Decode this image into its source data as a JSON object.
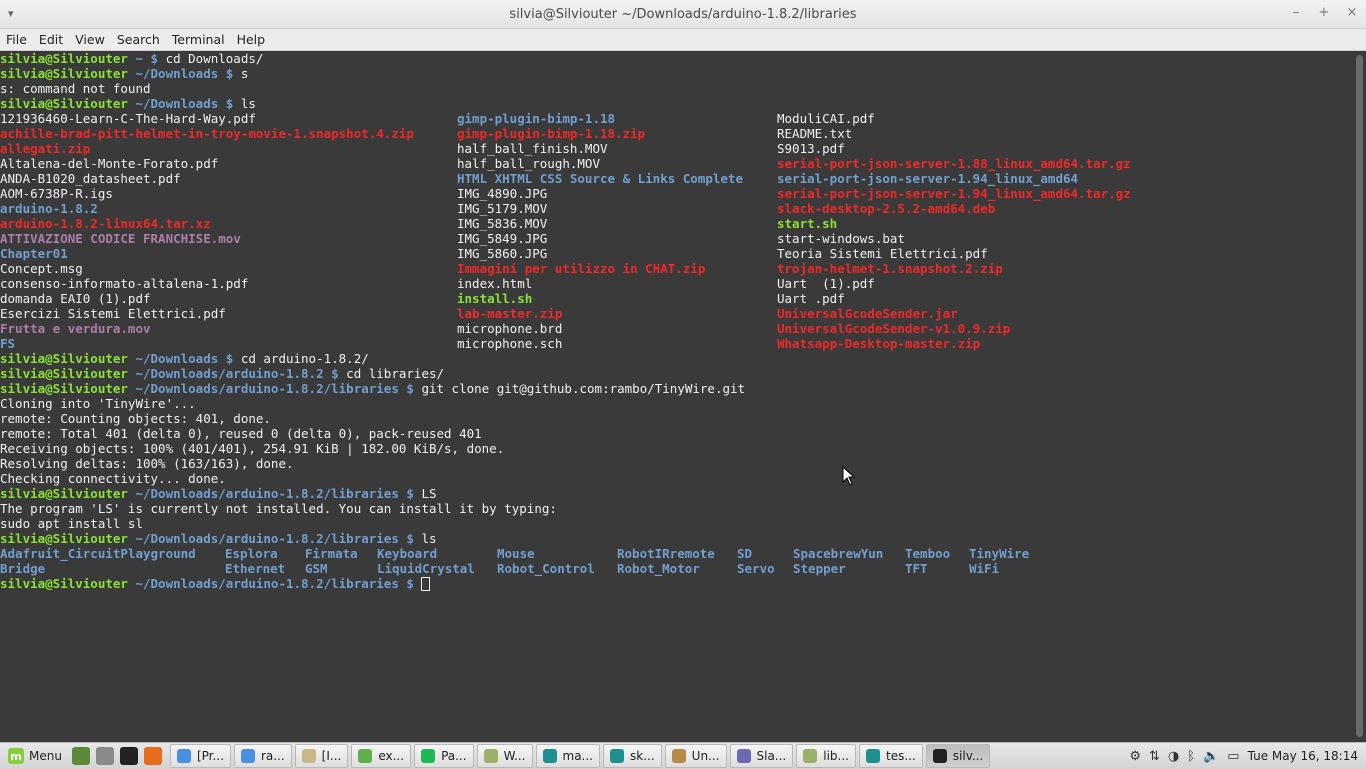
{
  "window": {
    "title": "silvia@Silviouter ~/Downloads/arduino-1.8.2/libraries",
    "menu_arrow": "▾",
    "min": "–",
    "max": "+",
    "close": "×"
  },
  "menubar": [
    "File",
    "Edit",
    "View",
    "Search",
    "Terminal",
    "Help"
  ],
  "terminal": {
    "user": "silvia@Silviouter",
    "lines_top": [
      {
        "path": " ~ $",
        "cmd": " cd Downloads/"
      },
      {
        "path": " ~/Downloads $",
        "cmd": " s"
      }
    ],
    "not_found": "s: command not found",
    "ls_cmd": {
      "path": " ~/Downloads $",
      "cmd": " ls"
    },
    "ls_col1": [
      {
        "t": "121936460-Learn-C-The-Hard-Way.pdf",
        "c": "norm"
      },
      {
        "t": "achille-brad-pitt-helmet-in-troy-movie-1.snapshot.4.zip",
        "c": "arc"
      },
      {
        "t": "allegati.zip",
        "c": "arc"
      },
      {
        "t": "Altalena-del-Monte-Forato.pdf",
        "c": "norm"
      },
      {
        "t": "ANDA-B1020_datasheet.pdf",
        "c": "norm"
      },
      {
        "t": "AOM-6738P-R.igs",
        "c": "norm"
      },
      {
        "t": "arduino-1.8.2",
        "c": "dir"
      },
      {
        "t": "arduino-1.8.2-linux64.tar.xz",
        "c": "arc"
      },
      {
        "t": "ATTIVAZIONE CODICE FRANCHISE.mov",
        "c": "mov"
      },
      {
        "t": "Chapter01",
        "c": "dir"
      },
      {
        "t": "Concept.msg",
        "c": "norm"
      },
      {
        "t": "consenso-informato-altalena-1.pdf",
        "c": "norm"
      },
      {
        "t": "domanda EAI0 (1).pdf",
        "c": "norm"
      },
      {
        "t": "Esercizi Sistemi Elettrici.pdf",
        "c": "norm"
      },
      {
        "t": "Frutta e verdura.mov",
        "c": "mov"
      },
      {
        "t": "FS",
        "c": "dir"
      }
    ],
    "ls_col2": [
      {
        "t": "gimp-plugin-bimp-1.18",
        "c": "dir"
      },
      {
        "t": "gimp-plugin-bimp-1.18.zip",
        "c": "arc"
      },
      {
        "t": "half_ball_finish.MOV",
        "c": "norm"
      },
      {
        "t": "half_ball_rough.MOV",
        "c": "norm"
      },
      {
        "t": "HTML XHTML CSS Source & Links Complete",
        "c": "dir"
      },
      {
        "t": "IMG_4890.JPG",
        "c": "norm"
      },
      {
        "t": "IMG_5179.MOV",
        "c": "norm"
      },
      {
        "t": "IMG_5836.MOV",
        "c": "norm"
      },
      {
        "t": "IMG_5849.JPG",
        "c": "norm"
      },
      {
        "t": "IMG_5860.JPG",
        "c": "norm"
      },
      {
        "t": "Immagini per utilizzo in CHAT.zip",
        "c": "arc"
      },
      {
        "t": "index.html",
        "c": "norm"
      },
      {
        "t": "install.sh",
        "c": "exe"
      },
      {
        "t": "lab-master.zip",
        "c": "arc"
      },
      {
        "t": "microphone.brd",
        "c": "norm"
      },
      {
        "t": "microphone.sch",
        "c": "norm"
      }
    ],
    "ls_col3": [
      {
        "t": "ModuliCAI.pdf",
        "c": "norm"
      },
      {
        "t": "README.txt",
        "c": "norm"
      },
      {
        "t": "S9013.pdf",
        "c": "norm"
      },
      {
        "t": "serial-port-json-server-1.88_linux_amd64.tar.gz",
        "c": "arc"
      },
      {
        "t": "serial-port-json-server-1.94_linux_amd64",
        "c": "dir"
      },
      {
        "t": "serial-port-json-server-1.94_linux_amd64.tar.gz",
        "c": "arc"
      },
      {
        "t": "slack-desktop-2.5.2-amd64.deb",
        "c": "arc"
      },
      {
        "t": "start.sh",
        "c": "exe"
      },
      {
        "t": "start-windows.bat",
        "c": "norm"
      },
      {
        "t": "Teoria Sistemi Elettrici.pdf",
        "c": "norm"
      },
      {
        "t": "trojan-helmet-1.snapshot.2.zip",
        "c": "arc"
      },
      {
        "t": "Uart  (1).pdf",
        "c": "norm"
      },
      {
        "t": "Uart .pdf",
        "c": "norm"
      },
      {
        "t": "UniversalGcodeSender.jar",
        "c": "arc"
      },
      {
        "t": "UniversalGcodeSender-v1.0.9.zip",
        "c": "arc"
      },
      {
        "t": "Whatsapp-Desktop-master.zip",
        "c": "arc"
      }
    ],
    "after_ls": [
      {
        "path": " ~/Downloads $",
        "cmd": " cd arduino-1.8.2/"
      },
      {
        "path": " ~/Downloads/arduino-1.8.2 $",
        "cmd": " cd libraries/"
      },
      {
        "path": " ~/Downloads/arduino-1.8.2/libraries $",
        "cmd": " git clone git@github.com:rambo/TinyWire.git"
      }
    ],
    "git_output": [
      "Cloning into 'TinyWire'...",
      "remote: Counting objects: 401, done.",
      "remote: Total 401 (delta 0), reused 0 (delta 0), pack-reused 401",
      "Receiving objects: 100% (401/401), 254.91 KiB | 182.00 KiB/s, done.",
      "Resolving deltas: 100% (163/163), done.",
      "Checking connectivity... done."
    ],
    "LS_cmd": {
      "path": " ~/Downloads/arduino-1.8.2/libraries $",
      "cmd": " LS"
    },
    "LS_output": [
      "The program 'LS' is currently not installed. You can install it by typing:",
      "sudo apt install sl"
    ],
    "ls2_cmd": {
      "path": " ~/Downloads/arduino-1.8.2/libraries $",
      "cmd": " ls"
    },
    "libs_row1": [
      "Adafruit_CircuitPlayground",
      "Esplora",
      "Firmata",
      "Keyboard",
      "Mouse",
      "RobotIRremote",
      "SD",
      "SpacebrewYun",
      "Temboo",
      "TinyWire"
    ],
    "libs_row2": [
      "Bridge",
      "Ethernet",
      "GSM",
      "LiquidCrystal",
      "Robot_Control",
      "Robot_Motor",
      "Servo",
      "Stepper",
      "TFT",
      "WiFi"
    ],
    "final_prompt": {
      "path": " ~/Downloads/arduino-1.8.2/libraries $",
      "cmd": " "
    }
  },
  "taskbar": {
    "menu_label": "Menu",
    "tasks": [
      {
        "label": "[Pr...",
        "icon_color": "#4a8fe0",
        "icon": "chrome-icon"
      },
      {
        "label": "ra...",
        "icon_color": "#4a8fe0",
        "icon": "chrome-icon"
      },
      {
        "label": "[I...",
        "icon_color": "#c8b889",
        "icon": "folder-icon"
      },
      {
        "label": "ex...",
        "icon_color": "#5fb04a",
        "icon": "app-icon"
      },
      {
        "label": "Pa...",
        "icon_color": "#1db954",
        "icon": "spotify-icon"
      },
      {
        "label": "W...",
        "icon_color": "#9bb068",
        "icon": "folder-icon"
      },
      {
        "label": "ma...",
        "icon_color": "#1f8f8f",
        "icon": "arduino-icon"
      },
      {
        "label": "sk...",
        "icon_color": "#1f8f8f",
        "icon": "arduino-icon"
      },
      {
        "label": "Un...",
        "icon_color": "#b88a4a",
        "icon": "document-icon"
      },
      {
        "label": "Sla...",
        "icon_color": "#6b6bb0",
        "icon": "window-icon"
      },
      {
        "label": "lib...",
        "icon_color": "#9bb068",
        "icon": "folder-icon"
      },
      {
        "label": "tes...",
        "icon_color": "#1f8f8f",
        "icon": "arduino-icon"
      },
      {
        "label": "silv...",
        "icon_color": "#222222",
        "icon": "terminal-icon",
        "active": true
      }
    ],
    "clock": "Tue May 16, 18:14"
  }
}
